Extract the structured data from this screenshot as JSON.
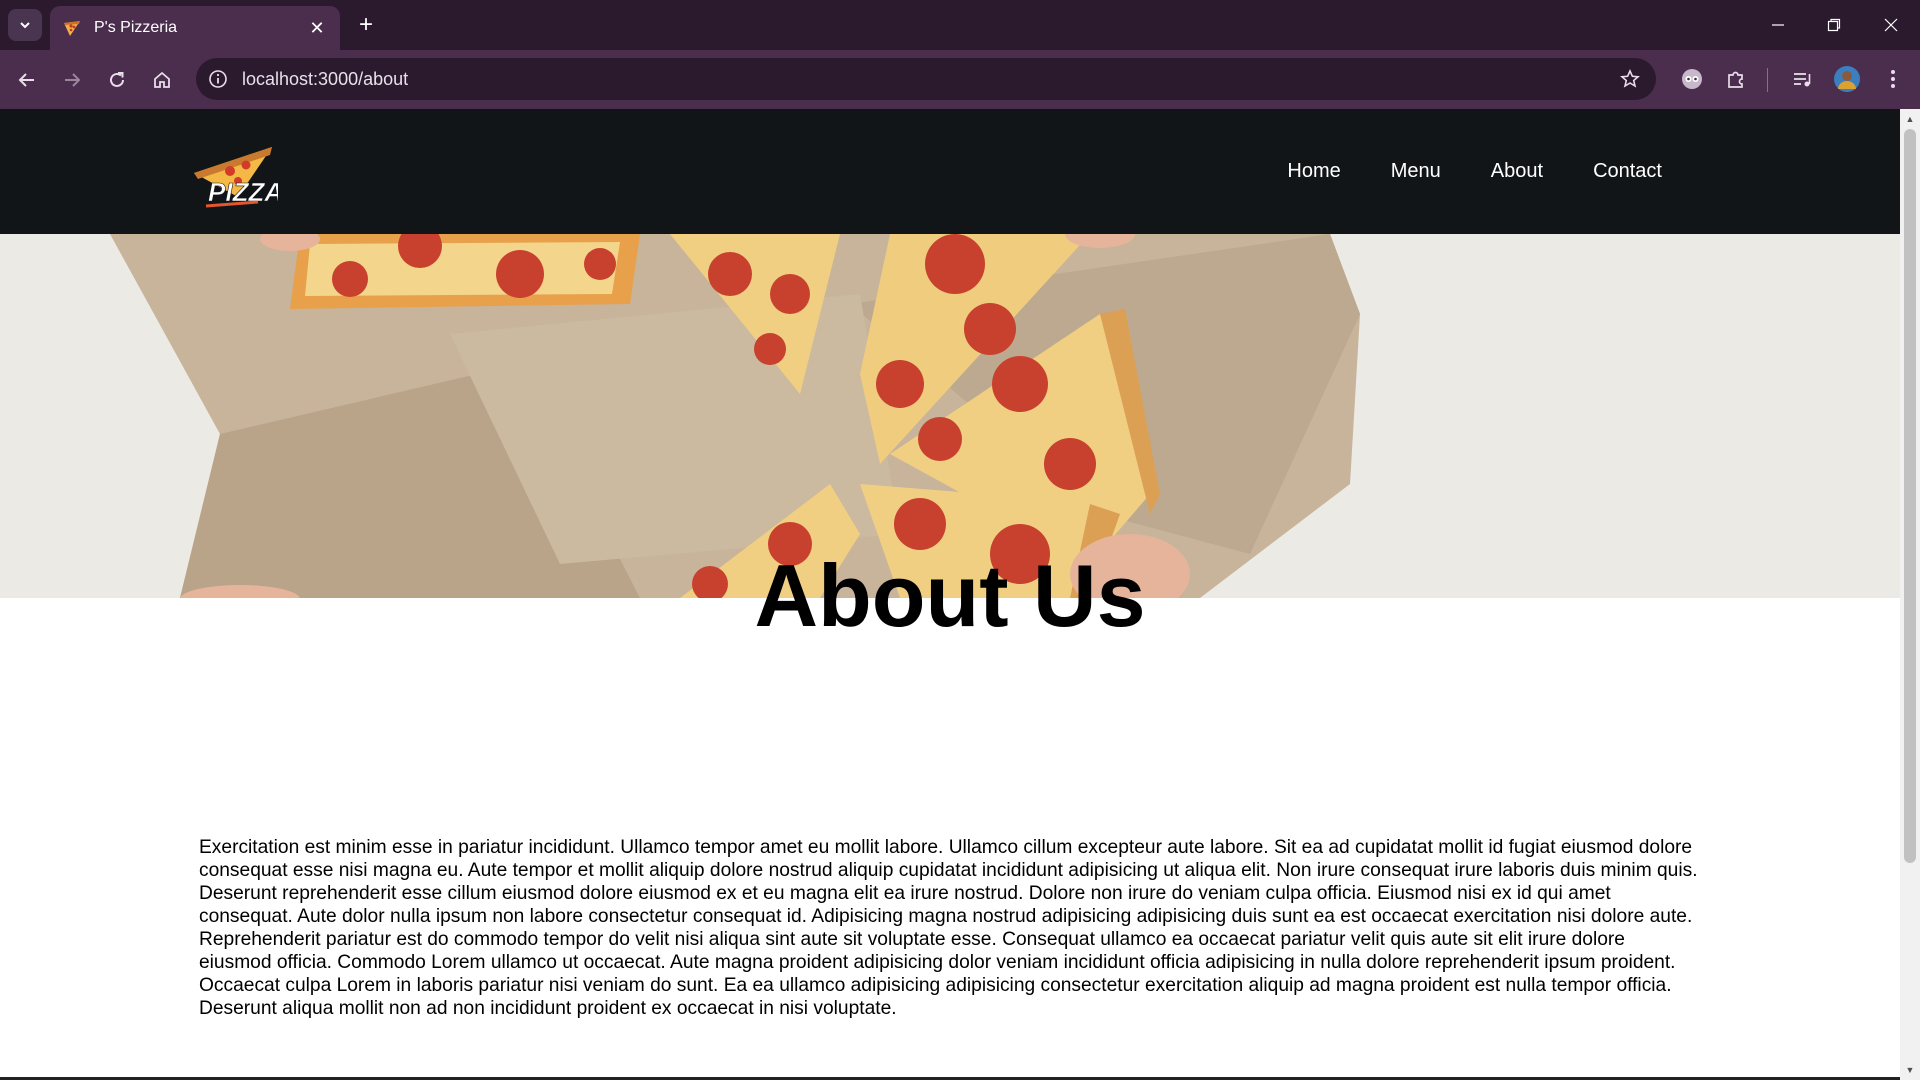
{
  "browser": {
    "tab_title": "P's Pizzeria",
    "url": "localhost:3000/about"
  },
  "site": {
    "logo_text": "PIZZA",
    "nav": [
      "Home",
      "Menu",
      "About",
      "Contact"
    ]
  },
  "about": {
    "title": "About Us",
    "body": "Exercitation est minim esse in pariatur incididunt. Ullamco tempor amet eu mollit labore. Ullamco cillum excepteur aute labore. Sit ea ad cupidatat mollit id fugiat eiusmod dolore consequat esse nisi magna eu. Aute tempor et mollit aliquip dolore nostrud aliquip cupidatat incididunt adipisicing ut aliqua elit. Non irure consequat irure laboris duis minim quis. Deserunt reprehenderit esse cillum eiusmod dolore eiusmod ex et eu magna elit ea irure nostrud. Dolore non irure do veniam culpa officia. Eiusmod nisi ex id qui amet consequat. Aute dolor nulla ipsum non labore consectetur consequat id. Adipisicing magna nostrud adipisicing adipisicing duis sunt ea est occaecat exercitation nisi dolore aute. Reprehenderit pariatur est do commodo tempor do velit nisi aliqua sint aute sit voluptate esse. Consequat ullamco ea occaecat pariatur velit quis aute sit elit irure dolore eiusmod officia. Commodo Lorem ullamco ut occaecat. Aute magna proident adipisicing dolor veniam incididunt officia adipisicing in nulla dolore reprehenderit ipsum proident. Occaecat culpa Lorem in laboris pariatur nisi veniam do sunt. Ea ea ullamco adipisicing adipisicing consectetur exercitation aliquip ad magna proident est nulla tempor officia. Deserunt aliqua mollit non ad non incididunt proident ex occaecat in nisi voluptate."
  },
  "icons": {
    "tab_list": "chevron-down-icon",
    "favicon": "pizza-favicon-icon",
    "close_tab": "close-icon",
    "new_tab": "plus-icon",
    "back": "arrow-left-icon",
    "forward": "arrow-right-icon",
    "reload": "reload-icon",
    "home": "home-icon",
    "site_info": "info-icon",
    "bookmark": "star-icon",
    "extension_1": "extension-eyes-icon",
    "extensions": "puzzle-icon",
    "media": "media-control-icon",
    "profile": "avatar",
    "menu": "kebab-menu-icon"
  },
  "colors": {
    "chrome_dark": "#2b1a2e",
    "chrome_tab": "#4b2d4d",
    "site_nav_bg": "#121518"
  }
}
